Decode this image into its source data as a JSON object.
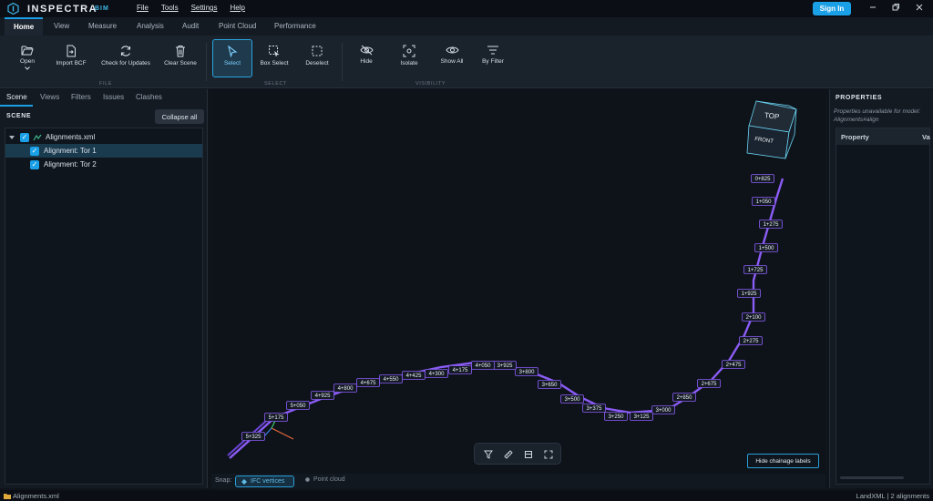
{
  "app": {
    "brand": "INSPECTRA",
    "brand_sub": "BIM",
    "menu": [
      "File",
      "Tools",
      "Settings",
      "Help"
    ],
    "sign_in": "Sign In",
    "window_controls": [
      "minimize-icon",
      "restore-icon",
      "close-icon"
    ]
  },
  "ribbon_tabs": [
    "Home",
    "View",
    "Measure",
    "Analysis",
    "Audit",
    "Point Cloud",
    "Performance"
  ],
  "ribbon": {
    "file": {
      "label": "FILE",
      "open": "Open",
      "import_bcf": "Import BCF",
      "check_updates": "Check for Updates",
      "clear_scene": "Clear Scene"
    },
    "select": {
      "label": "SELECT",
      "select": "Select",
      "box_select": "Box Select",
      "deselect": "Deselect"
    },
    "visibility": {
      "label": "VISIBILITY",
      "hide": "Hide",
      "isolate": "Isolate",
      "show_all": "Show All",
      "by_filter": "By Filter"
    }
  },
  "left_panel": {
    "tabs": [
      "Scene",
      "Views",
      "Filters",
      "Issues",
      "Clashes"
    ],
    "scene_label": "SCENE",
    "collapse_all": "Collapse all",
    "tree": {
      "root": "Alignments.xml",
      "children": [
        "Alignment: Tor 1",
        "Alignment: Tor 2"
      ]
    }
  },
  "right_panel": {
    "title": "PROPERTIES",
    "note": "Properties unavailable for model: Alignments#align",
    "columns": [
      "Property",
      "Va"
    ]
  },
  "viewport": {
    "view_cube": {
      "top": "TOP",
      "front": "FRONT"
    },
    "hide_labels": "Hide chainage labels",
    "stations": [
      "0+825",
      "1+050",
      "1+275",
      "1+500",
      "1+725",
      "1+925",
      "2+100",
      "2+275",
      "2+475",
      "2+675",
      "2+850",
      "3+000",
      "3+125",
      "3+250",
      "3+375",
      "3+500",
      "3+650",
      "3+800",
      "3+925",
      "4+050",
      "4+175",
      "4+300",
      "4+425",
      "4+550",
      "4+675",
      "4+800",
      "4+925",
      "5+050",
      "5+175",
      "5+325"
    ],
    "toolbar_icons": [
      "filter-icon",
      "ruler-icon",
      "section-icon",
      "fullscreen-icon"
    ]
  },
  "snap": {
    "label": "Snap:",
    "ifc": "IFC vertices",
    "point_cloud": "Point cloud"
  },
  "status": {
    "left": "Alignments.xml",
    "right": "LandXML | 2 alignments"
  },
  "colors": {
    "accent": "#1aa0e6",
    "alignment": "#8b5cf6",
    "background": "#0e131a"
  }
}
